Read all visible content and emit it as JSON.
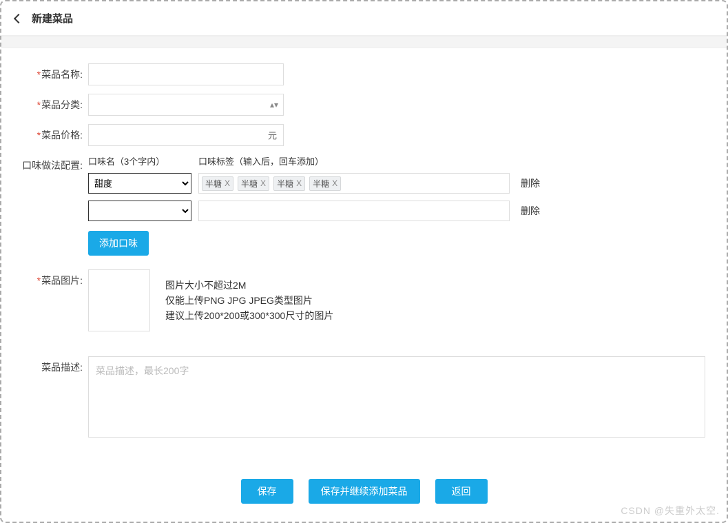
{
  "header": {
    "title": "新建菜品"
  },
  "fields": {
    "name": {
      "label": "菜品名称:",
      "value": ""
    },
    "category": {
      "label": "菜品分类:",
      "value": ""
    },
    "price": {
      "label": "菜品价格:",
      "value": "",
      "unit": "元"
    }
  },
  "flavor": {
    "label": "口味做法配置:",
    "col_name": "口味名（3个字内）",
    "col_tag": "口味标签（输入后，回车添加）",
    "rows": [
      {
        "select": "甜度",
        "tags": [
          "半糖",
          "半糖",
          "半糖",
          "半糖"
        ],
        "delete": "删除"
      },
      {
        "select": "",
        "tags": [],
        "delete": "删除"
      }
    ],
    "add_button": "添加口味"
  },
  "image": {
    "label": "菜品图片:",
    "hint1": "图片大小不超过2M",
    "hint2": "仅能上传PNG JPG JPEG类型图片",
    "hint3": "建议上传200*200或300*300尺寸的图片"
  },
  "desc": {
    "label": "菜品描述:",
    "placeholder": "菜品描述，最长200字",
    "value": ""
  },
  "footer": {
    "save": "保存",
    "save_continue": "保存并继续添加菜品",
    "back": "返回"
  },
  "watermark": "CSDN @失重外太空.",
  "colors": {
    "primary": "#1aa9e7"
  }
}
